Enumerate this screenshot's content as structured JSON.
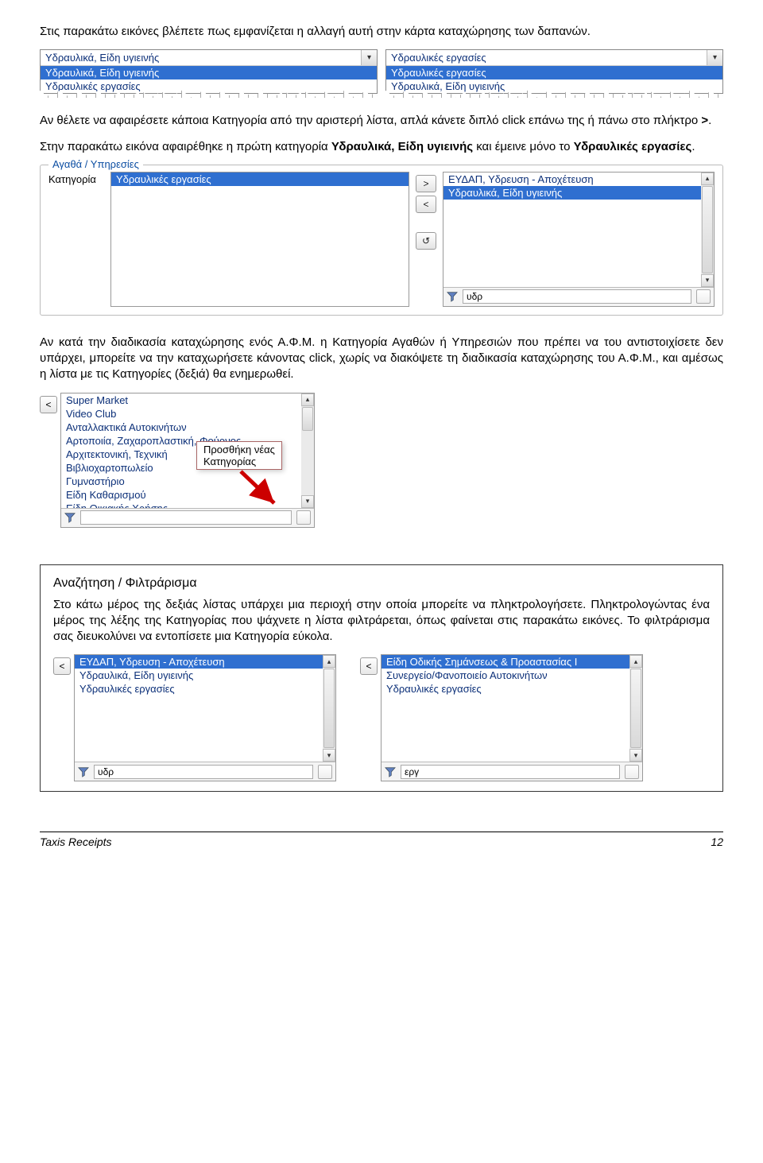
{
  "text": {
    "p1": "Στις παρακάτω εικόνες βλέπετε πως εμφανίζεται η αλλαγή αυτή στην κάρτα καταχώρησης των δαπανών.",
    "p2a": "Αν θέλετε να αφαιρέσετε κάποια Κατηγορία από την αριστερή λίστα, απλά κάνετε διπλό click επάνω της ή πάνω στο πλήκτρο ",
    "p2b": ">",
    "p2c": ".",
    "p3a": "Στην παρακάτω εικόνα αφαιρέθηκε η πρώτη κατηγορία ",
    "p3_bold1": "Υδραυλικά, Είδη υγιεινής",
    "p3b": " και έμεινε μόνο το ",
    "p3_bold2": "Υδραυλικές εργασίες",
    "p3c": ".",
    "p4": "Αν κατά την διαδικασία καταχώρησης ενός Α.Φ.Μ. η Κατηγορία Αγαθών ή Υπηρεσιών που πρέπει να του αντιστοιχίσετε δεν υπάρχει, μπορείτε να την καταχωρήσετε κάνοντας click, χωρίς να διακόψετε τη διαδικασία καταχώρησης του Α.Φ.Μ., και αμέσως η λίστα με τις Κατηγορίες (δεξιά) θα ενημερωθεί.",
    "frame_title": "Αναζήτηση / Φιλτράρισμα",
    "frame_body": "Στο κάτω μέρος της δεξιάς λίστας υπάρχει μια περιοχή στην οποία μπορείτε να πληκτρολογήσετε. Πληκτρολογώντας ένα μέρος της λέξης της Κατηγορίας που ψάχνετε η λίστα φιλτράρεται, όπως φαίνεται στις παρακάτω εικόνες. Το φιλτράρισμα σας διευκολύνει να εντοπίσετε μια Κατηγορία εύκολα."
  },
  "fig1": {
    "left": {
      "combo_selected": "Υδραυλικά, Είδη υγιεινής",
      "items": [
        "Υδραυλικά, Είδη υγιεινής",
        "Υδραυλικές εργασίες"
      ],
      "selected_index": 0
    },
    "right": {
      "combo_selected": "Υδραυλικές εργασίες",
      "items": [
        "Υδραυλικές εργασίες",
        "Υδραυλικά, Είδη υγιεινής"
      ],
      "selected_index": 0
    }
  },
  "fig2": {
    "legend": "Αγαθά / Υπηρεσίες",
    "label": "Κατηγορία",
    "left_items": [
      "Υδραυλικές εργασίες"
    ],
    "left_selected": 0,
    "right_items": [
      "ΕΥΔΑΠ, Υδρευση - Αποχέτευση",
      "Υδραυλικά, Είδη υγιεινής"
    ],
    "right_selected": 1,
    "filter_value": "υδρ",
    "btn_right": ">",
    "btn_left": "<",
    "btn_refresh": "↺"
  },
  "fig3": {
    "items": [
      "Super Market",
      "Video Club",
      "Ανταλλακτικά Αυτοκινήτων",
      "Αρτοποιία, Ζαχαροπλαστική, Φούρνος",
      "Αρχιτεκτονική, Τεχνική",
      "Βιβλιοχαρτοπωλείο",
      "Γυμναστήριο",
      "Είδη Καθαρισμού",
      "Είδη Οικιακής Χρήσης"
    ],
    "tooltip_l1": "Προσθήκη νέας",
    "tooltip_l2": "Κατηγορίας",
    "filter_value": ""
  },
  "frame_boxes": {
    "left": {
      "items": [
        "ΕΥΔΑΠ, Υδρευση - Αποχέτευση",
        "Υδραυλικά, Είδη υγιεινής",
        "Υδραυλικές εργασίες"
      ],
      "selected": 0,
      "filter": "υδρ"
    },
    "right": {
      "items": [
        "Είδη Οδικής Σημάνσεως & Προαστασίας Ι",
        "Συνεργείο/Φανοποιείο Αυτοκινήτων",
        "Υδραυλικές εργασίες"
      ],
      "selected": 0,
      "filter": "εργ"
    }
  },
  "footer": {
    "left": "Taxis Receipts",
    "right": "12"
  }
}
